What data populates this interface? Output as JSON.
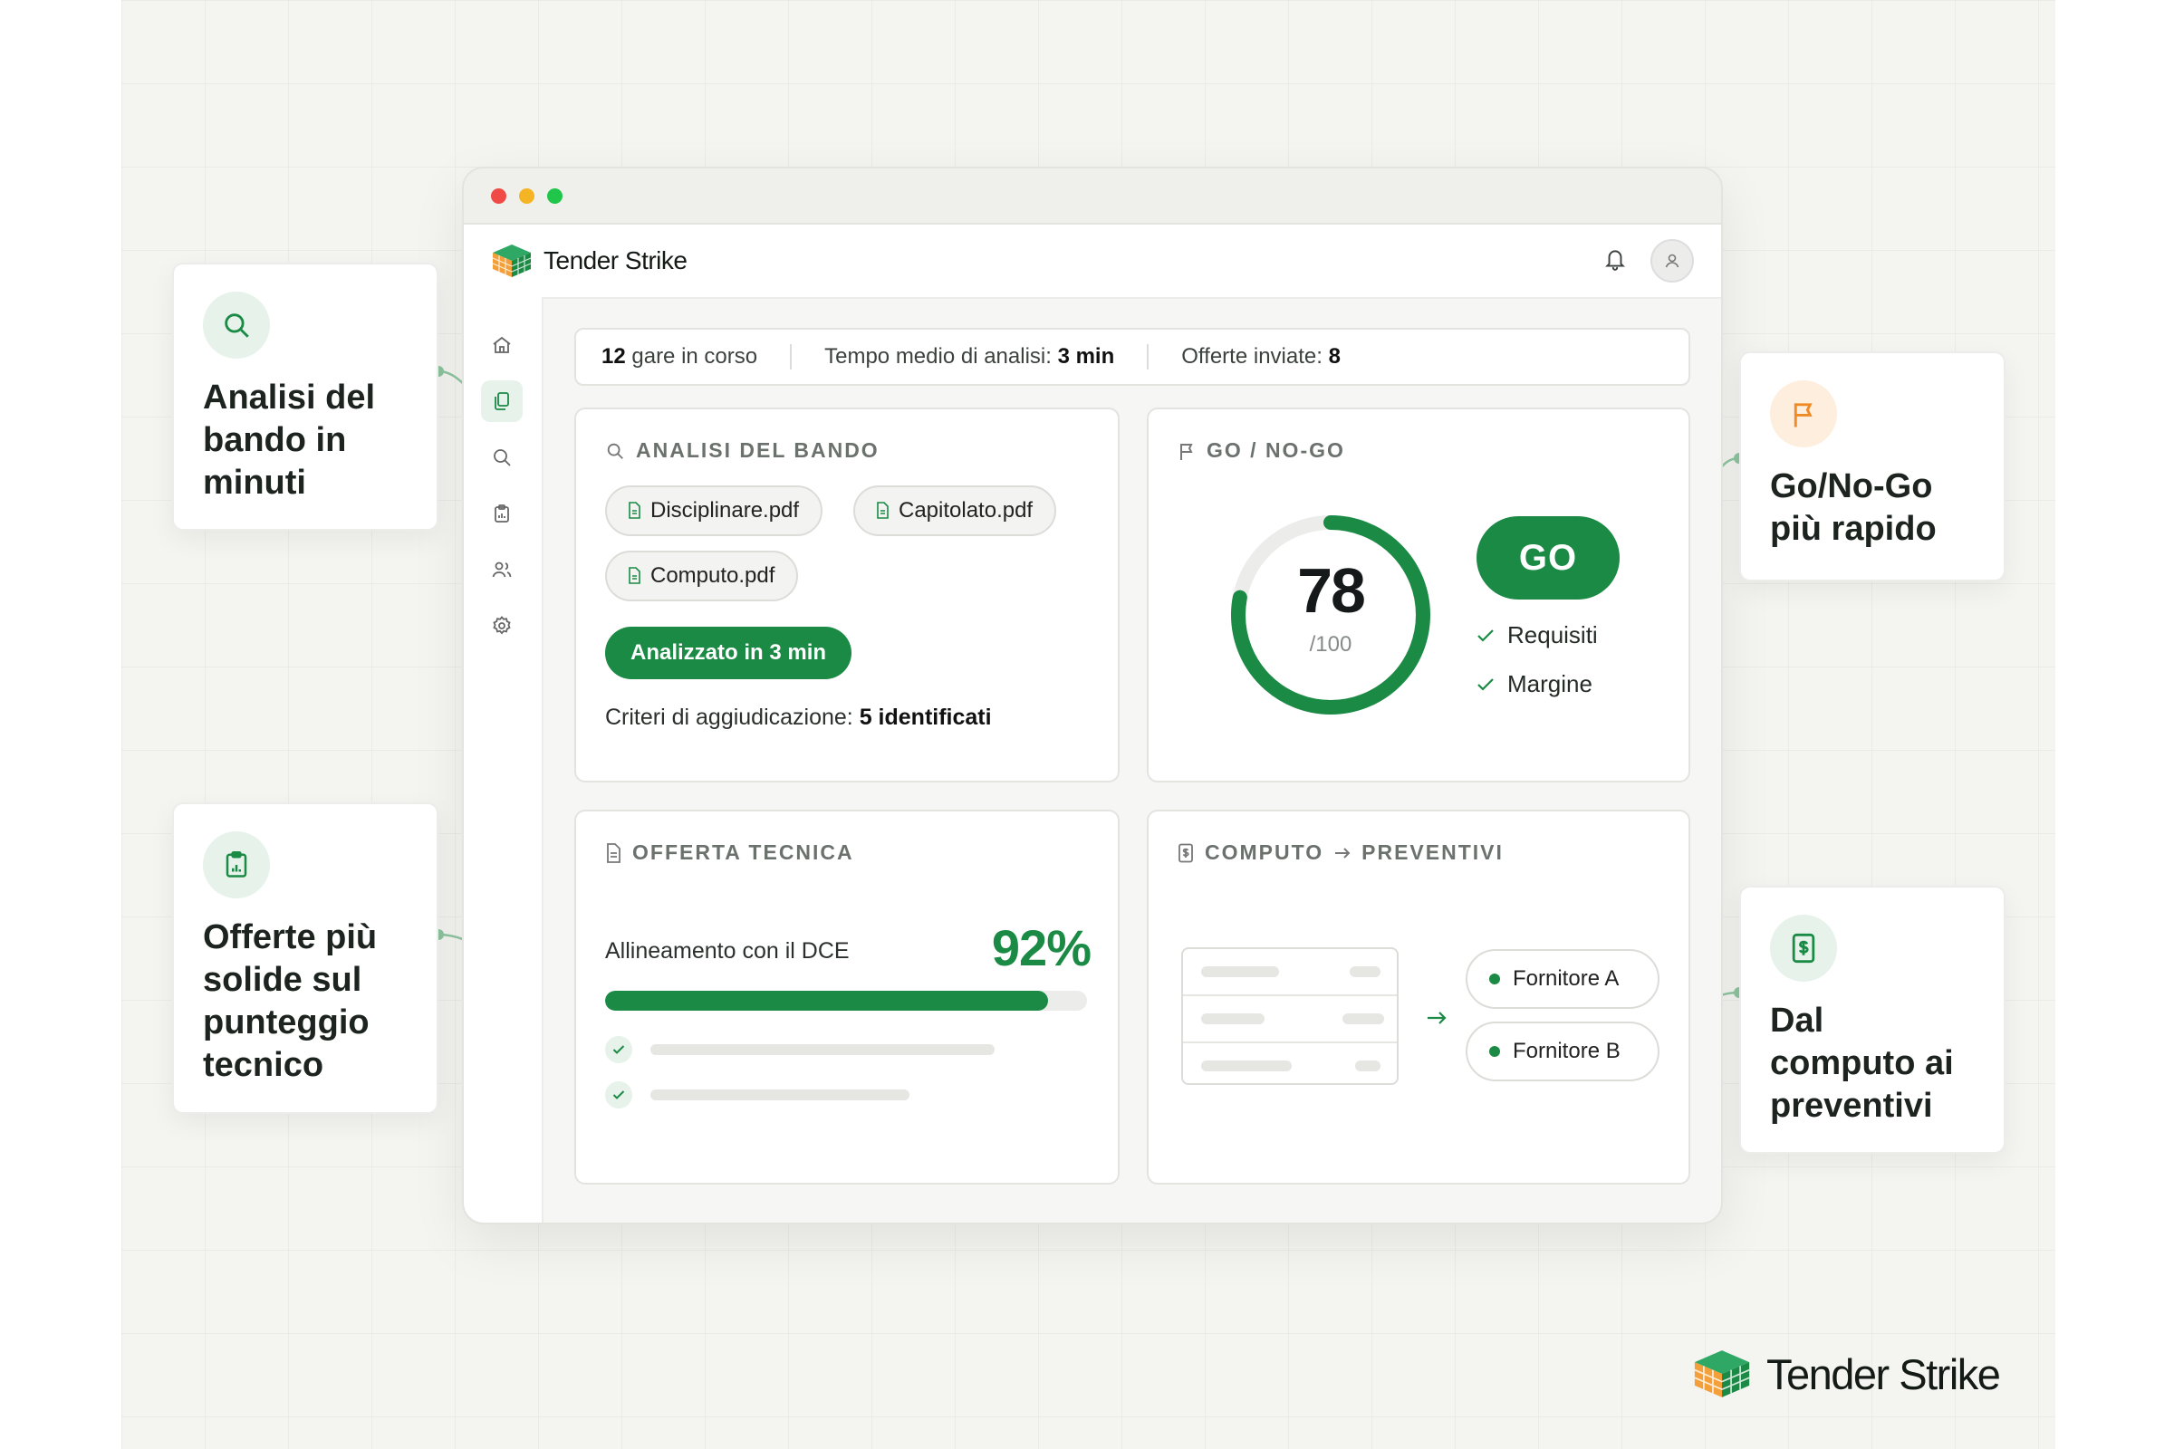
{
  "brand": {
    "name": "Tender Strike"
  },
  "stats": {
    "gare_count": "12",
    "gare_label": " gare in corso",
    "tempo_label": "Tempo medio di analisi: ",
    "tempo_value": "3 min",
    "offerte_label": "Offerte inviate: ",
    "offerte_value": "8"
  },
  "analisi": {
    "title": "ANALISI DEL BANDO",
    "files": [
      "Disciplinare.pdf",
      "Capitolato.pdf",
      "Computo.pdf"
    ],
    "status": "Analizzato in 3 min",
    "criteria_label": "Criteri di aggiudicazione: ",
    "criteria_value": "5 identificati"
  },
  "gonogo": {
    "title": "GO / NO-GO",
    "score": "78",
    "score_max": "/100",
    "score_fraction": 0.78,
    "decision": "GO",
    "checks": [
      "Requisiti",
      "Margine"
    ]
  },
  "offerta": {
    "title": "OFFERTA TECNICA",
    "align_label": "Allineamento con il DCE",
    "align_value": "92%",
    "align_fraction": 0.92
  },
  "computo": {
    "title_left": "COMPUTO",
    "title_right": "PREVENTIVI",
    "suppliers": [
      "Fornitore A",
      "Fornitore B"
    ]
  },
  "callouts": {
    "analisi": "Analisi del\nbando in\nminuti",
    "offerte": "Offerte più\nsolide sul\npunteggio\ntecnico",
    "gonogo": "Go/No-Go\npiù rapido",
    "computo": "Dal\ncomputo ai\npreventivi"
  },
  "colors": {
    "accent": "#1a8a45",
    "accent_light": "#e6f2ea",
    "orange": "#f08a24",
    "orange_light": "#fdeedd"
  },
  "icons": {
    "sidebar": [
      "home-icon",
      "documents-icon",
      "search-icon",
      "clipboard-icon",
      "users-icon",
      "settings-icon"
    ],
    "appbar": [
      "bell-icon",
      "user-icon"
    ]
  }
}
